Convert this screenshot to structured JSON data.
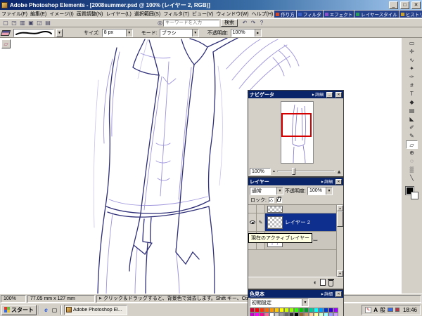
{
  "window": {
    "title": "Adobe Photoshop Elements - [2008summer.psd @ 100% (レイヤー 2, RGB)]"
  },
  "icons": {
    "minimize": "_",
    "maximize": "□",
    "close": "✕",
    "restore": "❐",
    "dropdown": "▼",
    "more_arrow": "▶",
    "popup_arrow": "▶",
    "hint_arrow": "▶",
    "zoom_out": "▲",
    "zoom_in": "▲",
    "scroll_up": "▲",
    "scroll_down": "▼",
    "search": "◎",
    "paint_indicator": "✎",
    "adjustment_layer": "◐",
    "eraser_float": "▱"
  },
  "menu_bar": {
    "items": [
      "ファイル(F)",
      "編集(E)",
      "イメージ(I)",
      "画質調整(N)",
      "レイヤー(L)",
      "選択範囲(S)",
      "フィルタ(T)",
      "ビュー(V)",
      "ウィンドウ(W)",
      "ヘルプ(H)"
    ]
  },
  "palette_well": {
    "tabs": [
      {
        "label": "作り方",
        "color": "#d04828"
      },
      {
        "label": "フィルタ",
        "color": "#3a5fc8"
      },
      {
        "label": "エフェクト",
        "color": "#8a4fc8"
      },
      {
        "label": "レイヤースタイル",
        "color": "#2a9a58"
      },
      {
        "label": "ヒストリー",
        "color": "#c8a02a"
      },
      {
        "label": "ヒント",
        "color": "#38a8c8"
      }
    ]
  },
  "shortcuts_bar": {
    "left_icons": [
      {
        "name": "new-document-icon",
        "glyph": "▢"
      },
      {
        "name": "open-folder-icon",
        "glyph": "◳"
      },
      {
        "name": "file-browser-icon",
        "glyph": "▥"
      },
      {
        "name": "save-icon",
        "glyph": "▣"
      },
      {
        "name": "import-icon",
        "glyph": "◲"
      },
      {
        "name": "print-icon",
        "glyph": "▤"
      }
    ],
    "search_placeholder": "キーワードを入力",
    "search_button_label": "検索",
    "right_icons": [
      {
        "name": "undo-icon",
        "glyph": "↶"
      },
      {
        "name": "redo-icon",
        "glyph": "↷"
      },
      {
        "name": "help-icon",
        "glyph": "?"
      }
    ]
  },
  "options_bar": {
    "size_label": "サイズ:",
    "size_value": "8 px",
    "mode_label": "モード:",
    "mode_value": "ブラシ",
    "opacity_label": "不透明度:",
    "opacity_value": "100%"
  },
  "toolbox": {
    "tools": [
      {
        "name": "rectangular-marquee-tool",
        "glyph": "▭"
      },
      {
        "name": "move-tool",
        "glyph": "✛"
      },
      {
        "name": "lasso-tool",
        "glyph": "∿"
      },
      {
        "name": "magic-wand-tool",
        "glyph": "✦"
      },
      {
        "name": "selection-brush-tool",
        "glyph": "✑"
      },
      {
        "name": "crop-tool",
        "glyph": "#"
      },
      {
        "name": "type-tool",
        "glyph": "T"
      },
      {
        "name": "shape-tool",
        "glyph": "◆"
      },
      {
        "name": "gradient-tool",
        "glyph": "▤"
      },
      {
        "name": "paint-bucket-tool",
        "glyph": "◣"
      },
      {
        "name": "brush-tool",
        "glyph": "✐"
      },
      {
        "name": "pencil-tool",
        "glyph": "✎"
      },
      {
        "name": "eraser-tool",
        "glyph": "▱",
        "active": true
      },
      {
        "name": "clone-stamp-tool",
        "glyph": "⊕"
      },
      {
        "name": "blur-tool",
        "glyph": "◌"
      },
      {
        "name": "sponge-tool",
        "glyph": "▒"
      },
      {
        "name": "eyedropper-tool",
        "glyph": "╲"
      }
    ]
  },
  "navigator": {
    "title": "ナビゲータ",
    "more_label": "詳細",
    "zoom_value": "100%"
  },
  "layers": {
    "title": "レイヤー",
    "more_label": "詳細",
    "blend_mode": "通常",
    "opacity_label": "不透明度:",
    "opacity_value": "100%",
    "lock_label": "ロック:",
    "layer2_name": "レイヤー 2",
    "bg_copy_name": "背景 のコピー",
    "tooltip": "現在のアクティブレイヤー"
  },
  "swatches": {
    "title": "色見本",
    "more_label": "詳細",
    "preset": "初期設定",
    "colors": [
      "#cc0033",
      "#ff0000",
      "#ff3300",
      "#ff6600",
      "#ff9900",
      "#ffcc00",
      "#ffff00",
      "#ccff00",
      "#99ff00",
      "#33ff00",
      "#00cc00",
      "#009933",
      "#00cc99",
      "#00ffff",
      "#0099ff",
      "#0033cc",
      "#3300cc",
      "#9900ff",
      "#cc00cc",
      "#ff00ff",
      "#ff0099",
      "#ff6699",
      "#ffffff",
      "#cccccc",
      "#999999",
      "#666666",
      "#333333",
      "#000000",
      "#996633",
      "#cc9966",
      "#ffcc99",
      "#ffff99",
      "#ccffcc",
      "#99ffff",
      "#9999ff",
      "#cc99ff"
    ]
  },
  "status_bar": {
    "zoom": "100%",
    "doc_size": "77.05 mm x 127 mm",
    "hint": "クリック＆ドラッグすると、背景色で消去します。Shift キー、Ctrl キーで"
  },
  "taskbar": {
    "start_label": "スタート",
    "quick_launch": [
      {
        "name": "ie-icon",
        "glyph": "e",
        "cls": "ql-ie"
      },
      {
        "name": "show-desktop-icon",
        "glyph": "▢",
        "cls": ""
      }
    ],
    "task_label": "Adobe Photoshop El...",
    "ime_input": "A",
    "ime_mode": "般",
    "time": "18:46"
  }
}
